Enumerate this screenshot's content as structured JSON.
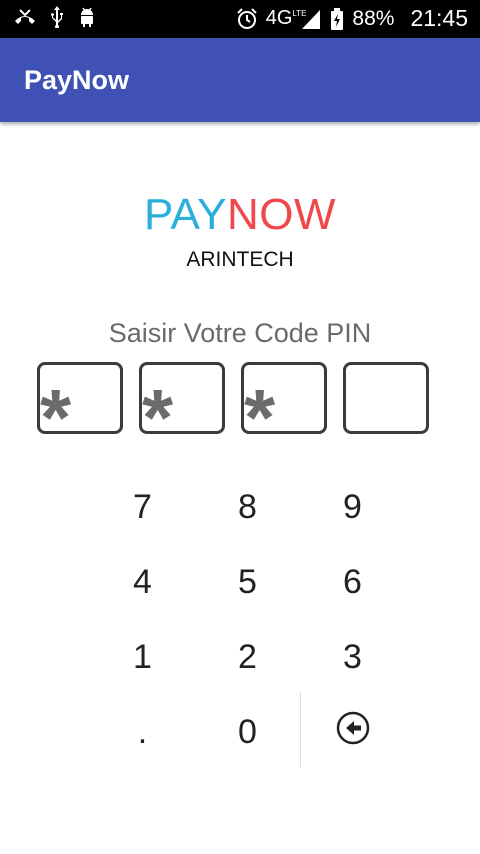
{
  "statusbar": {
    "network": "4G",
    "network_sup": "LTE",
    "battery": "88%",
    "time": "21:45",
    "icons": [
      "missed-call-icon",
      "usb-icon",
      "android-icon",
      "alarm-icon",
      "signal-icon",
      "battery-icon"
    ]
  },
  "appbar": {
    "title": "PayNow",
    "color": "#3F51B5"
  },
  "logo": {
    "part1": "PAY",
    "part2": "NOW",
    "part1_color": "#2AAEDC",
    "part2_color": "#F0474B"
  },
  "company": "ARINTECH",
  "pin": {
    "prompt": "Saisir Votre Code PIN",
    "boxes": [
      "*",
      "*",
      "*",
      ""
    ]
  },
  "keypad": {
    "keys": [
      "7",
      "8",
      "9",
      "4",
      "5",
      "6",
      "1",
      "2",
      "3",
      ".",
      "0"
    ],
    "backspace_icon": "backspace-icon"
  }
}
